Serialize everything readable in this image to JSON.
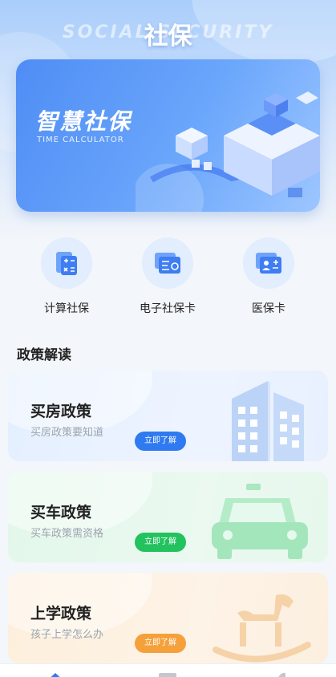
{
  "header": {
    "title_zh": "社保",
    "title_en": "SOCIAL SECURITY"
  },
  "banner": {
    "title": "智慧社保",
    "subtitle": "TIME CALCULATOR"
  },
  "quick_actions": [
    {
      "label": "计算社保",
      "icon": "calculator-icon"
    },
    {
      "label": "电子社保卡",
      "icon": "electronic-card-icon"
    },
    {
      "label": "医保卡",
      "icon": "id-card-icon"
    }
  ],
  "section": {
    "title": "政策解读"
  },
  "policies": [
    {
      "title": "买房政策",
      "subtitle": "买房政策要知道",
      "button": "立即了解",
      "color": "#2f7af0",
      "icon": "building-icon"
    },
    {
      "title": "买车政策",
      "subtitle": "买车政策需资格",
      "button": "立即了解",
      "color": "#22c25e",
      "icon": "car-icon"
    },
    {
      "title": "上学政策",
      "subtitle": "孩子上学怎么办",
      "button": "立即了解",
      "color": "#f5a13b",
      "icon": "rocking-horse-icon"
    }
  ],
  "tabbar": {
    "tabs": [
      "home-icon",
      "list-icon",
      "profile-icon"
    ]
  }
}
